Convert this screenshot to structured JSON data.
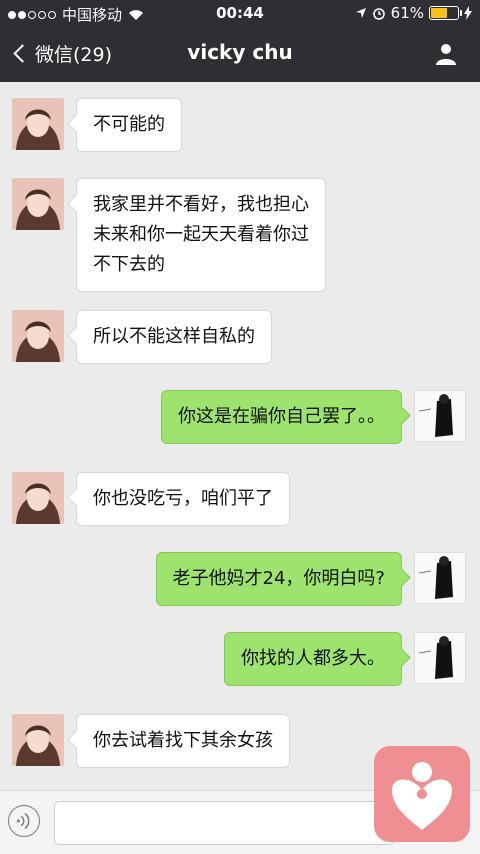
{
  "status": {
    "carrier": "中国移动",
    "time": "00:44",
    "battery": "61%",
    "battery_level": 0.61,
    "battery_color": "#f6c219"
  },
  "nav": {
    "back_label": "微信(29)",
    "title": "vicky chu",
    "profile_icon": "person-icon"
  },
  "messages": [
    {
      "side": "in",
      "text": "不可能的"
    },
    {
      "side": "in",
      "text": "我家里并不看好，我也担心\n未来和你一起天天看着你过\n不下去的"
    },
    {
      "side": "in",
      "text": "所以不能这样自私的"
    },
    {
      "side": "out",
      "text": "你这是在骗你自己罢了。。"
    },
    {
      "side": "in",
      "text": "你也没吃亏，咱们平了"
    },
    {
      "side": "out",
      "text": "老子他妈才24，你明白吗?"
    },
    {
      "side": "out",
      "text": "你找的人都多大。"
    },
    {
      "side": "in",
      "text": "你去试着找下其余女孩"
    }
  ],
  "input": {
    "voice_icon": "voice-icon",
    "placeholder": ""
  },
  "colors": {
    "nav_bg": "#2e2e33",
    "chat_bg": "#ebebeb",
    "bubble_out": "#9de36d",
    "bubble_in": "#ffffff",
    "overlay_logo": "#ef8f93"
  }
}
